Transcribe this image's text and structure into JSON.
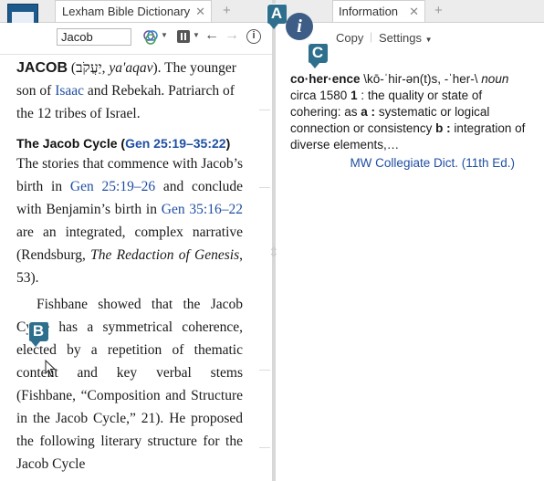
{
  "left_panel": {
    "tab_title": "Lexham Bible Dictionary",
    "search_value": "Jacob",
    "entry": {
      "headword": "JACOB",
      "hebrew": "יַעֲקֹב",
      "transliteration": "ya'aqav",
      "intro_rest": "). The younger son of ",
      "isaac": "Isaac",
      "intro_end": " and Rebekah. Patriarch of the 12 tribes of Israel."
    },
    "section": {
      "heading": "The Jacob Cycle",
      "ref": "Gen 25:19–35:22",
      "p1_a": "The stories that commence with Jacob’s birth in ",
      "ref_a": "Gen 25:19–26",
      "p1_b": " and conclude with Benjamin’s birth in ",
      "ref_b": "Gen 35:16–22",
      "p1_c": " are an integrated, complex narrative (Rendsburg, ",
      "book": "The Redaction of Genesis",
      "p1_d": ", 53).",
      "p2": "Fishbane showed that the Jacob Cycle has a symmetrical coherence, elected by a repetition of thematic content and key verbal stems (Fishbane, “Composition and Structure in the Jacob Cycle,” 21). He proposed the following literary structure for the Jacob Cycle"
    }
  },
  "right_panel": {
    "tab_title": "Information",
    "copy_label": "Copy",
    "settings_label": "Settings",
    "definition": {
      "headword": "co·her·ence",
      "pron": " \\kō-ˈhir-ən(t)s, -ˈher-\\ ",
      "pos": "noun",
      "date": "circa 1580",
      "sense_num": "1",
      "sense_text": " : the quality or state of cohering: as ",
      "a_label": "a :",
      "a_text": " systematic or logical connection or consistency ",
      "b_label": "b :",
      "b_text": " integration of diverse elements,…"
    },
    "source": "MW Collegiate Dict. (11th Ed.)"
  },
  "callouts": {
    "a": "A",
    "b": "B",
    "c": "C"
  },
  "info_badge": "i",
  "colors": {
    "link": "#1f4fa3",
    "callout": "#2e6f8e",
    "info": "#3e5d86"
  }
}
